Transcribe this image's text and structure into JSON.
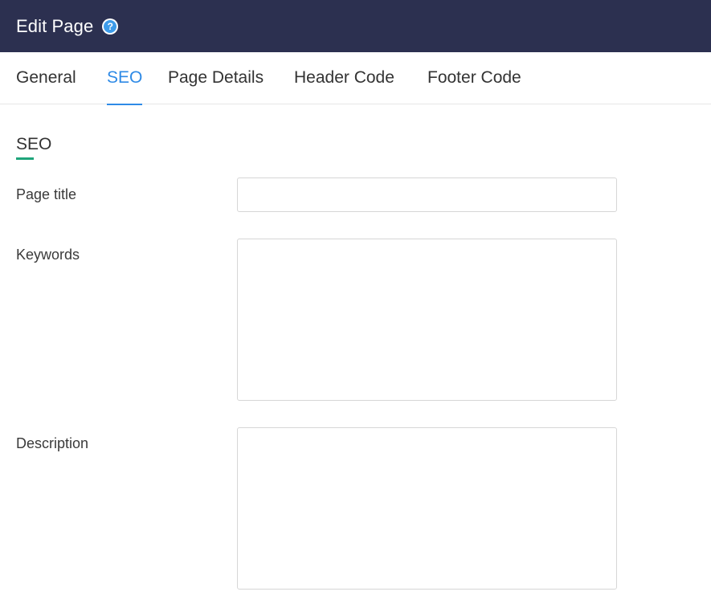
{
  "header": {
    "title": "Edit Page",
    "help_icon_glyph": "?"
  },
  "tabs": [
    {
      "label": "General",
      "active": false
    },
    {
      "label": "SEO",
      "active": true
    },
    {
      "label": "Page Details",
      "active": false
    },
    {
      "label": "Header Code",
      "active": false
    },
    {
      "label": "Footer Code",
      "active": false
    }
  ],
  "seo": {
    "section_title": "SEO",
    "page_title_label": "Page title",
    "page_title_value": "",
    "keywords_label": "Keywords",
    "keywords_value": "",
    "description_label": "Description",
    "description_value": ""
  },
  "colors": {
    "header_bg": "#2c3050",
    "active_tab": "#2e8ae6",
    "section_accent": "#1fa57b",
    "help_icon": "#3d9be9"
  }
}
